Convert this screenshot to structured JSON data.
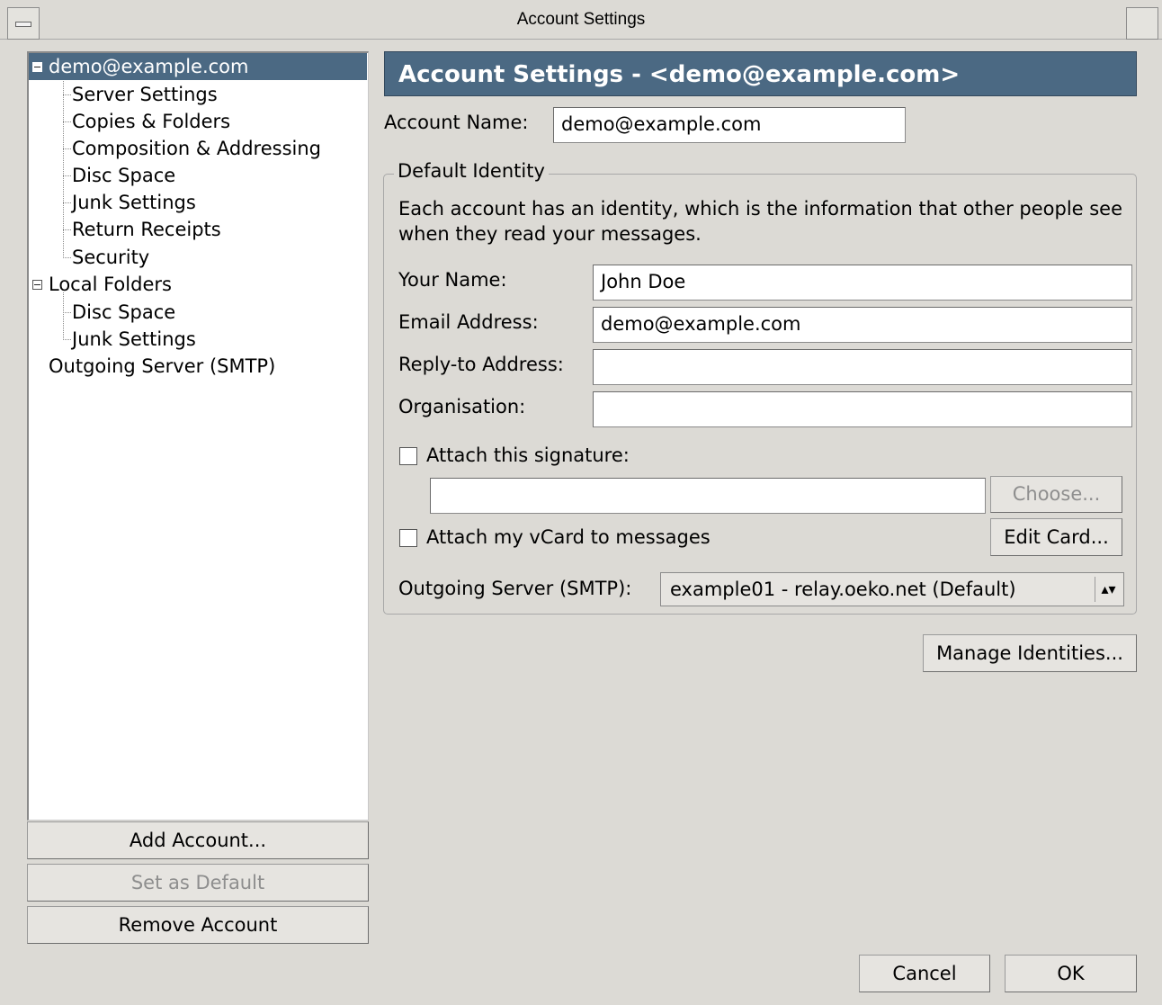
{
  "window": {
    "title": "Account Settings"
  },
  "tree": {
    "account": "demo@example.com",
    "account_children": [
      "Server Settings",
      "Copies & Folders",
      "Composition & Addressing",
      "Disc Space",
      "Junk Settings",
      "Return Receipts",
      "Security"
    ],
    "local_folders": "Local Folders",
    "local_children": [
      "Disc Space",
      "Junk Settings"
    ],
    "outgoing": "Outgoing Server (SMTP)"
  },
  "left_buttons": {
    "add": "Add Account...",
    "set_default": "Set as Default",
    "remove": "Remove Account"
  },
  "header": {
    "title": "Account Settings - <demo@example.com>"
  },
  "account_name": {
    "label": "Account Name:",
    "value": "demo@example.com"
  },
  "identity": {
    "title": "Default Identity",
    "description": "Each account has an identity, which is the information that other people see when they read your messages.",
    "your_name": {
      "label": "Your Name:",
      "value": "John Doe"
    },
    "email": {
      "label": "Email Address:",
      "value": "demo@example.com"
    },
    "reply_to": {
      "label": "Reply-to Address:",
      "value": ""
    },
    "organisation": {
      "label": "Organisation:",
      "value": ""
    },
    "signature": {
      "label": "Attach this signature:",
      "checked": false,
      "value": "",
      "choose": "Choose..."
    },
    "vcard": {
      "label": "Attach my vCard to messages",
      "checked": false,
      "edit": "Edit Card..."
    },
    "smtp": {
      "label": "Outgoing Server (SMTP):",
      "value": "example01 - relay.oeko.net (Default)"
    }
  },
  "manage_identities": "Manage Identities...",
  "dialog_buttons": {
    "cancel": "Cancel",
    "ok": "OK"
  }
}
